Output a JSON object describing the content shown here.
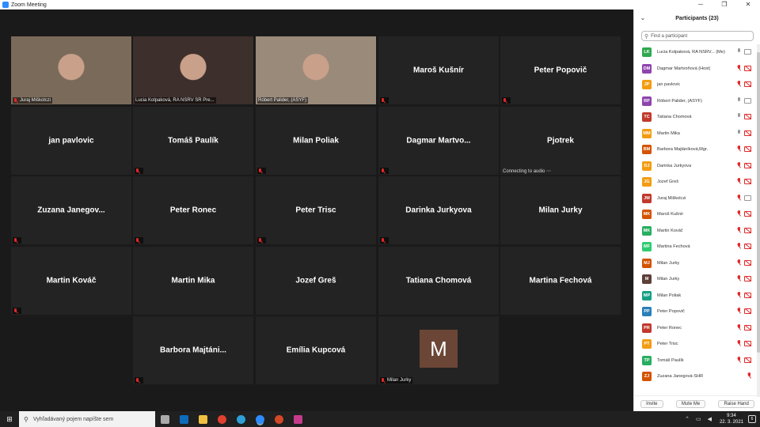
{
  "window": {
    "title": "Zoom Meeting"
  },
  "tiles": [
    {
      "name": "Juraj Miškolczi",
      "caption": "Juraj Miškolczi",
      "video": true,
      "muted": true
    },
    {
      "name": "Lucia Kolpaková, RA NSRV SR Pre...",
      "caption": "Lucia Kolpaková, RA NSRV SR Pre...",
      "video": true,
      "muted": false
    },
    {
      "name": "Róbert Palider, (ASYF)",
      "caption": "Róbert Palider, (ASYF)",
      "video": true,
      "muted": false,
      "active": true
    },
    {
      "name": "Maroš Kušnír",
      "muted": true
    },
    {
      "name": "Peter Popovič",
      "muted": true
    },
    {
      "name": "jan pavlovic",
      "muted": false
    },
    {
      "name": "Tomáš Paulík",
      "muted": true
    },
    {
      "name": "Milan Poliak",
      "muted": true
    },
    {
      "name": "Dagmar  Martvo...",
      "muted": true
    },
    {
      "name": "Pjotrek",
      "muted": false,
      "status": "Connecting to audio ⋯"
    },
    {
      "name": "Zuzana  Janegov...",
      "muted": true
    },
    {
      "name": "Peter Ronec",
      "muted": true
    },
    {
      "name": "Peter Trisc",
      "muted": true
    },
    {
      "name": "Darinka Jurkyova",
      "muted": true
    },
    {
      "name": "Milan Jurky",
      "muted": false
    },
    {
      "name": "Martin Kováč",
      "muted": true
    },
    {
      "name": "Martin Mika",
      "muted": false
    },
    {
      "name": "Jozef Greš",
      "muted": false
    },
    {
      "name": "Tatiana Chomová",
      "muted": false
    },
    {
      "name": "Martina Fechová",
      "muted": false
    },
    {
      "name": "Barbora  Majtáni...",
      "muted": true
    },
    {
      "name": "Emília Kupcová",
      "muted": false
    },
    {
      "name": "",
      "caption": "Milan Jurky",
      "avatar": "M",
      "muted": true
    }
  ],
  "participants_panel": {
    "header": "Participants (23)",
    "search_placeholder": "Find a participant",
    "participants": [
      {
        "initials": "LK",
        "color": "#2fa84f",
        "name": "Lucia Kolpaková, RA NSRV...  (Me)",
        "mic": "on",
        "cam": "on"
      },
      {
        "initials": "DM",
        "color": "#8e44ad",
        "name": "Dagmar Martvoňová (Host)",
        "mic": "off",
        "cam": "off"
      },
      {
        "initials": "JP",
        "color": "#f39c12",
        "name": "jan pavlovic",
        "mic": "off",
        "cam": "off"
      },
      {
        "initials": "RP",
        "color": "#8e44ad",
        "name": "Róbert Palider, (ASYF)",
        "mic": "on",
        "cam": "on"
      },
      {
        "initials": "TC",
        "color": "#c0392b",
        "name": "Tatiana Chomová",
        "mic": "on",
        "cam": "off"
      },
      {
        "initials": "MM",
        "color": "#f39c12",
        "name": "Martin Mika",
        "mic": "on",
        "cam": "off"
      },
      {
        "initials": "BM",
        "color": "#d35400",
        "name": "Barbora Majtáníková,Mgr.",
        "mic": "off",
        "cam": "off"
      },
      {
        "initials": "DJ",
        "color": "#f39c12",
        "name": "Darinka Jurkyova",
        "mic": "off",
        "cam": "off"
      },
      {
        "initials": "JG",
        "color": "#f39c12",
        "name": "Jozef Greš",
        "mic": "off",
        "cam": "off"
      },
      {
        "initials": "JM",
        "color": "#c0392b",
        "name": "Juraj Miškolczi",
        "mic": "off",
        "cam": "on"
      },
      {
        "initials": "MK",
        "color": "#d35400",
        "name": "Maroš Kušnír",
        "mic": "off",
        "cam": "off"
      },
      {
        "initials": "MK",
        "color": "#27ae60",
        "name": "Martin Kováč",
        "mic": "off",
        "cam": "off"
      },
      {
        "initials": "MF",
        "color": "#2ecc71",
        "name": "Martina Fechová",
        "mic": "off",
        "cam": "off"
      },
      {
        "initials": "MJ",
        "color": "#d35400",
        "name": "Milan Jurky",
        "mic": "off",
        "cam": "off"
      },
      {
        "initials": "M",
        "color": "#5d4037",
        "name": "Milan Jurky",
        "mic": "off",
        "cam": "off"
      },
      {
        "initials": "MP",
        "color": "#16a085",
        "name": "Milan Poliak",
        "mic": "off",
        "cam": "off"
      },
      {
        "initials": "PP",
        "color": "#2980b9",
        "name": "Peter Popovič",
        "mic": "off",
        "cam": "off"
      },
      {
        "initials": "PR",
        "color": "#c0392b",
        "name": "Peter Ronec",
        "mic": "off",
        "cam": "off"
      },
      {
        "initials": "PT",
        "color": "#f39c12",
        "name": "Peter Trisc",
        "mic": "off",
        "cam": "off"
      },
      {
        "initials": "TP",
        "color": "#27ae60",
        "name": "Tomáš Paulík",
        "mic": "off",
        "cam": "off"
      },
      {
        "initials": "ZJ",
        "color": "#d35400",
        "name": "Zuzana Janegová-SHR",
        "mic": "off",
        "cam": "none"
      }
    ],
    "footer": {
      "invite": "Invite",
      "mute_me": "Mute Me",
      "raise_hand": "Raise Hand"
    }
  },
  "taskbar": {
    "search_placeholder": "Vyhľadávaný pojem napíšte sem",
    "apps": [
      {
        "name": "task-view",
        "color": "#aaaaaa"
      },
      {
        "name": "outlook",
        "color": "#0f6cbd"
      },
      {
        "name": "file-explorer",
        "color": "#f0c040"
      },
      {
        "name": "chrome",
        "color": "#e04030"
      },
      {
        "name": "edge",
        "color": "#2ea0d8"
      },
      {
        "name": "zoom",
        "color": "#2d8cff",
        "active": true
      },
      {
        "name": "powerpoint",
        "color": "#d24726"
      },
      {
        "name": "app-drop",
        "color": "#c63a8a"
      }
    ],
    "time": "9:34",
    "date": "22. 3. 2021",
    "notifications": "6"
  }
}
